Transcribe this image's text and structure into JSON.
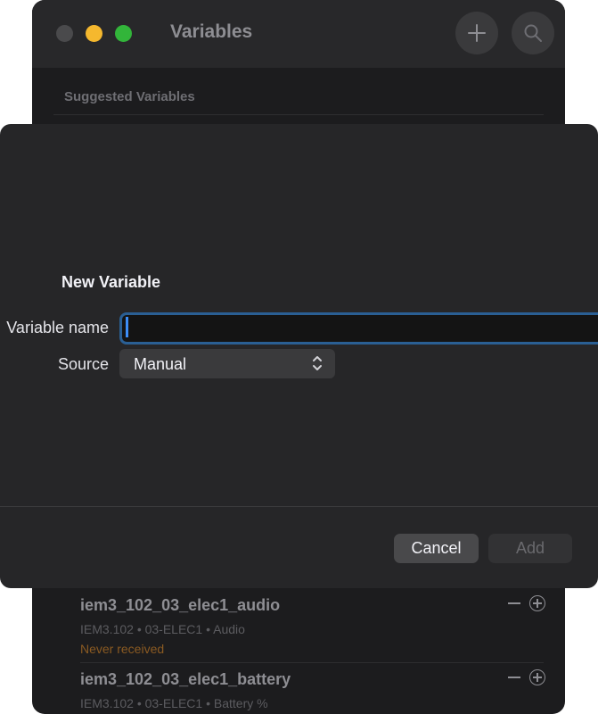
{
  "window": {
    "title": "Variables",
    "toolbar": {
      "add_icon": "plus-icon",
      "search_icon": "magnifier-icon"
    },
    "section_header": "Suggested Variables"
  },
  "variables": [
    {
      "name": "iem3_102_03_elec1_audio",
      "meta": "IEM3.102 • 03-ELEC1 • Audio",
      "status": "Never received"
    },
    {
      "name": "iem3_102_03_elec1_battery",
      "meta": "IEM3.102 • 03-ELEC1 • Battery %"
    }
  ],
  "sheet": {
    "title": "New Variable",
    "name_label": "Variable name",
    "name_value": "",
    "source_label": "Source",
    "source_value": "Manual",
    "cancel_label": "Cancel",
    "add_label": "Add"
  },
  "colors": {
    "accent": "#2a5f94",
    "caret": "#3d8ef7",
    "close": "#4a4a4c",
    "minimize": "#f5b82e",
    "maximize": "#32b53a",
    "status_warning": "#8a5a22"
  }
}
